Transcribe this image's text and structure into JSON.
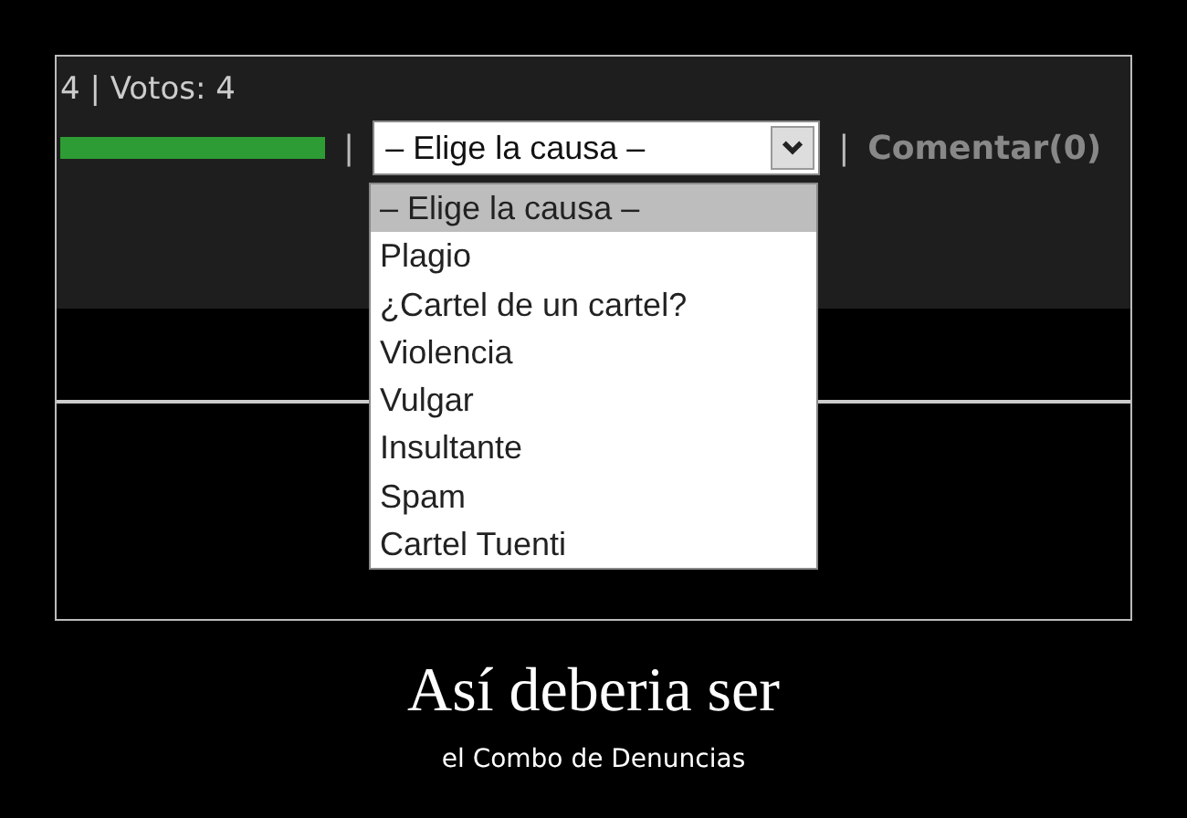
{
  "screen": {
    "votes_line": "4 | Votos: 4",
    "separators": [
      "|",
      "|"
    ],
    "select": {
      "value": "– Elige la causa –",
      "options": [
        {
          "label": "– Elige la causa –",
          "selected": true
        },
        {
          "label": "Plagio",
          "selected": false
        },
        {
          "label": "¿Cartel de un cartel?",
          "selected": false
        },
        {
          "label": "Violencia",
          "selected": false
        },
        {
          "label": "Vulgar",
          "selected": false
        },
        {
          "label": "Insultante",
          "selected": false
        },
        {
          "label": "Spam",
          "selected": false
        },
        {
          "label": "Cartel Tuenti",
          "selected": false
        }
      ]
    },
    "comment_link": "Comentar(0)"
  },
  "poster": {
    "title": "Así deberia ser",
    "caption": "el Combo de Denuncias"
  }
}
